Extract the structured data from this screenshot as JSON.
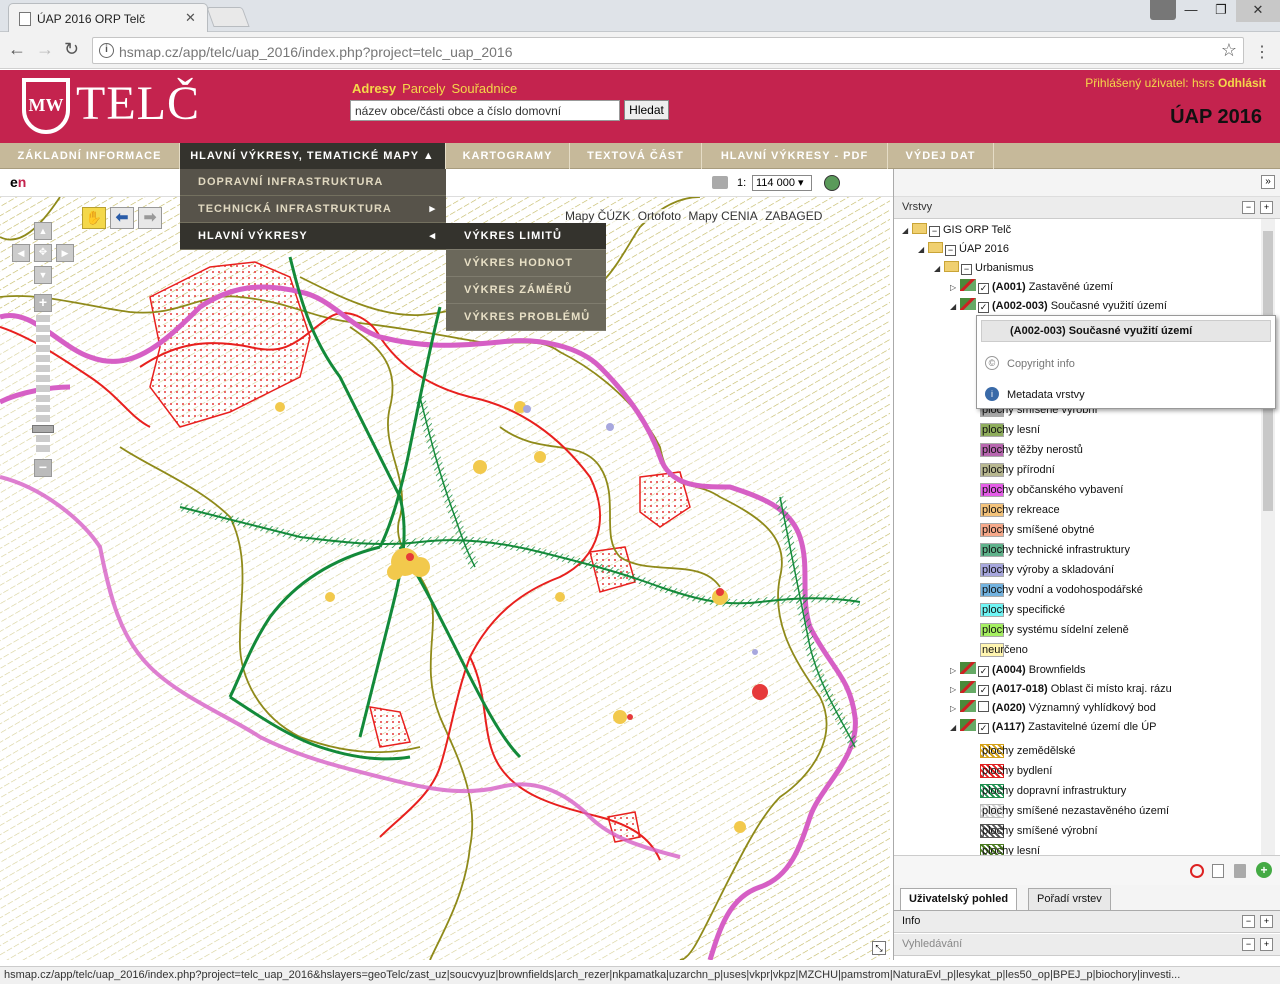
{
  "browser": {
    "tab_title": "ÚAP 2016 ORP Telč",
    "url_host": "hsmap.cz",
    "url_path": "/app/telc/uap_2016/index.php?project=telc_uap_2016",
    "status_url": "hsmap.cz/app/telc/uap_2016/index.php?project=telc_uap_2016&hslayers=geoTelc/zast_uz|soucvyuz|brownfields|arch_rezer|nkpamatka|uzarchn_p|uses|vkpr|vkpz|MZCHU|pamstrom|NaturaEvl_p|lesykat_p|les50_op|BPEJ_p|biochory|investi..."
  },
  "header": {
    "brand": "TELČ",
    "logo_text": "MW",
    "search_tabs": [
      "Adresy",
      "Parcely",
      "Souřadnice"
    ],
    "search_placeholder": "název obce/části obce a číslo domovní",
    "search_button": "Hledat",
    "login_label": "Přihlášený uživatel: hsrs",
    "logout_label": "Odhlásit",
    "app_title": "ÚAP 2016"
  },
  "menu": {
    "items": [
      "ZÁKLADNÍ INFORMACE",
      "HLAVNÍ VÝKRESY, TEMATICKÉ MAPY",
      "KARTOGRAMY",
      "TEXTOVÁ ČÁST",
      "HLAVNÍ VÝKRESY - PDF",
      "VÝDEJ DAT"
    ],
    "active_arrow": "▲",
    "dropdown": [
      "DOPRAVNÍ INFRASTRUKTURA",
      "TECHNICKÁ INFRASTRUKTURA",
      "HLAVNÍ VÝKRESY"
    ],
    "dropdown_arrows": [
      "",
      "▸",
      "◂"
    ],
    "submenu": [
      "VÝKRES LIMITŮ",
      "VÝKRES HODNOT",
      "VÝKRES ZÁMĚRŮ",
      "VÝKRES PROBLÉMŮ"
    ]
  },
  "toolbar": {
    "logo_e": "e",
    "logo_n": "n",
    "scale_label": "1:",
    "scale_value": "114 000"
  },
  "map": {
    "basemaps": [
      "Mapy ČÚZK",
      "Ortofoto",
      "Mapy CENIA",
      "ZABAGED"
    ],
    "colors": {
      "border": "#d65fc5",
      "red": "#e8201e",
      "olive": "#8f8a1a",
      "green": "#138a3a"
    }
  },
  "panel": {
    "layers_title": "Vrstvy",
    "tree": [
      {
        "label": "GIS ORP Telč"
      },
      {
        "label": "ÚAP 2016"
      },
      {
        "label": "Urbanismus"
      },
      {
        "code": "(A001)",
        "label": "Zastavěné území"
      },
      {
        "code": "(A002-003)",
        "label": "Současné využití území"
      }
    ],
    "popup": {
      "title": "(A002-003) Současné využití území",
      "copyright": "Copyright info",
      "metadata": "Metadata vrstvy"
    },
    "legend1": [
      {
        "label": "plochy smíšené výrobní",
        "color": "#a9a9a9"
      },
      {
        "label": "plochy lesní",
        "color": "#8fae5c"
      },
      {
        "label": "plochy těžby nerostů",
        "color": "#b866b0"
      },
      {
        "label": "plochy přírodní",
        "color": "#b8b890"
      },
      {
        "label": "plochy občanského vybavení",
        "color": "#e55ce8"
      },
      {
        "label": "plochy rekreace",
        "color": "#f4c37a"
      },
      {
        "label": "plochy smíšené obytné",
        "color": "#f7a98a"
      },
      {
        "label": "plochy technické infrastruktury",
        "color": "#5fb38b"
      },
      {
        "label": "plochy výroby a skladování",
        "color": "#a7a7de"
      },
      {
        "label": "plochy vodní a vodohospodářské",
        "color": "#72b3e0"
      },
      {
        "label": "plochy specifické",
        "color": "#6ff5f5"
      },
      {
        "label": "plochy systému sídelní zeleně",
        "color": "#a6f061"
      },
      {
        "label": "neurčeno",
        "color": "#fff5b0"
      }
    ],
    "tree2": [
      {
        "code": "(A004)",
        "label": "Brownfields",
        "checked": true
      },
      {
        "code": "(A017-018)",
        "label": "Oblast či místo kraj. rázu",
        "checked": true
      },
      {
        "code": "(A020)",
        "label": "Významný vyhlídkový bod",
        "checked": false
      },
      {
        "code": "(A117)",
        "label": "Zastavitelné území dle ÚP",
        "checked": true
      }
    ],
    "legend2": [
      {
        "label": "plochy zemědělské",
        "color": "#d4a017"
      },
      {
        "label": "plochy bydlení",
        "color": "#e02020"
      },
      {
        "label": "plochy dopravní infrastruktury",
        "color": "#209050"
      },
      {
        "label": "plochy smíšené nezastavěného území",
        "color": "#cccccc"
      },
      {
        "label": "plochy smíšené výrobní",
        "color": "#555555"
      },
      {
        "label": "plochy lesní",
        "color": "#4a7a20"
      }
    ],
    "tabs": [
      "Uživatelský pohled",
      "Pořadí vrstev"
    ],
    "sections": [
      "Info",
      "Vyhledávání"
    ]
  }
}
